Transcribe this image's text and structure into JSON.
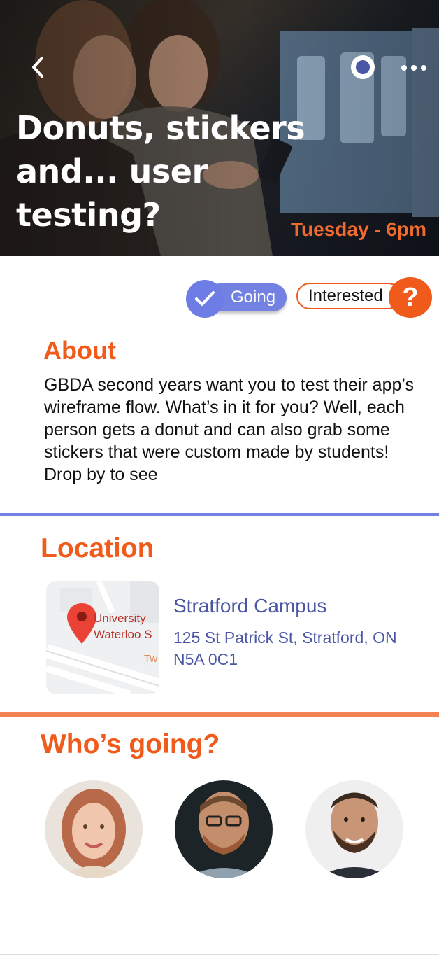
{
  "header": {
    "title": "Donuts, stickers and... user testing?",
    "date": "Tuesday - 6pm",
    "back_icon": "chevron-left-icon",
    "record_icon": "record-icon",
    "more_icon": "more-horizontal-icon"
  },
  "rsvp": {
    "going_label": "Going",
    "interested_label": "Interested",
    "interested_badge": "?",
    "going_selected": true
  },
  "about": {
    "heading": "About",
    "body": "GBDA second years want you to test their app’s wireframe flow. What’s in it for you? Well, each person gets a donut and can also grab some stickers that were custom made by students! Drop by to see"
  },
  "location": {
    "heading": "Location",
    "venue": "Stratford Campus",
    "address": "125 St Patrick St, Stratford, ON N5A 0C1",
    "map_labels": [
      "University",
      "Waterloo S",
      "Tw"
    ]
  },
  "attendees": {
    "heading": "Who’s going?",
    "people": [
      "attendee-1",
      "attendee-2",
      "attendee-3"
    ]
  },
  "colors": {
    "accent_orange": "#f05a1a",
    "accent_blue": "#7381e3",
    "link_blue": "#4a56a6"
  }
}
